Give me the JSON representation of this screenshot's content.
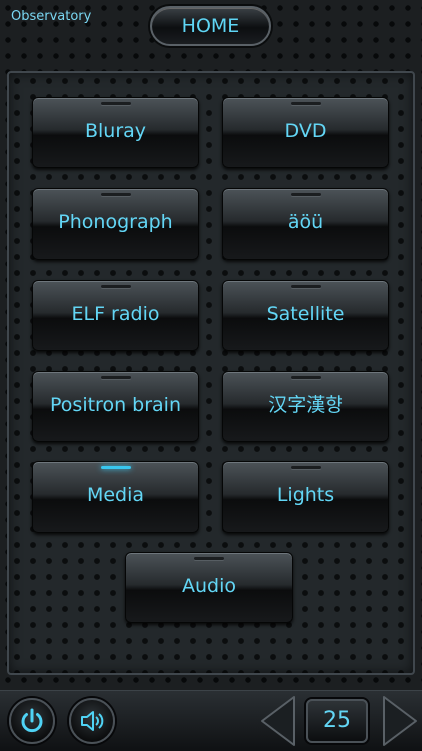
{
  "header": {
    "location": "Observatory",
    "home_label": "HOME"
  },
  "activities": [
    {
      "label": "Bluray",
      "active": false
    },
    {
      "label": "DVD",
      "active": false
    },
    {
      "label": "Phonograph",
      "active": false
    },
    {
      "label": "äöü",
      "active": false
    },
    {
      "label": "ELF radio",
      "active": false
    },
    {
      "label": "Satellite",
      "active": false
    },
    {
      "label": "Positron brain",
      "active": false
    },
    {
      "label": "汉字漢향",
      "active": false
    },
    {
      "label": "Media",
      "active": true
    },
    {
      "label": "Lights",
      "active": false
    },
    {
      "label": "Audio",
      "active": false
    }
  ],
  "footer": {
    "power_icon": "power-icon",
    "volume_icon": "speaker-icon",
    "channel": "25"
  },
  "colors": {
    "accent": "#5fd6f5",
    "active_indicator": "#38c7f0"
  }
}
